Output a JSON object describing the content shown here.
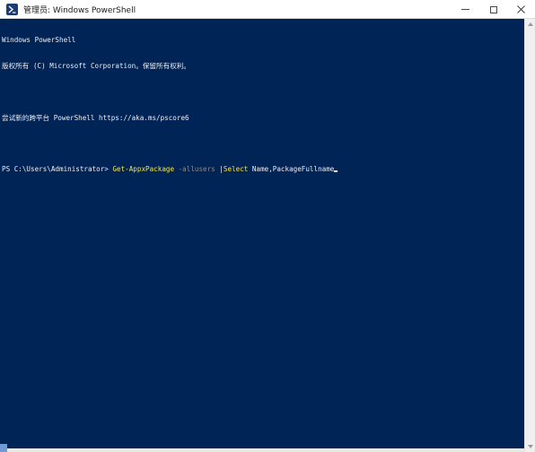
{
  "window": {
    "title": "管理员: Windows PowerShell",
    "background_color": "#012456",
    "text_color": "#eeedf0",
    "icon": "powershell-icon"
  },
  "caption_buttons": {
    "minimize_icon": "minimize-icon",
    "maximize_icon": "maximize-icon",
    "close_icon": "close-icon"
  },
  "console": {
    "header_line1": "Windows PowerShell",
    "header_line2": "版权所有 (C) Microsoft Corporation。保留所有权利。",
    "header_line3": "尝试新的跨平台 PowerShell https://aka.ms/pscore6",
    "prompt": "PS C:\\Users\\Administrator> ",
    "command": {
      "cmdlet": "Get-AppxPackage",
      "parameter": "-allusers",
      "pipe": "|",
      "next_cmdlet": "Select",
      "argument": " Name,PackageFullname"
    },
    "colors": {
      "cmdlet": "#f5e44f",
      "parameter": "#8c8c8c"
    }
  }
}
